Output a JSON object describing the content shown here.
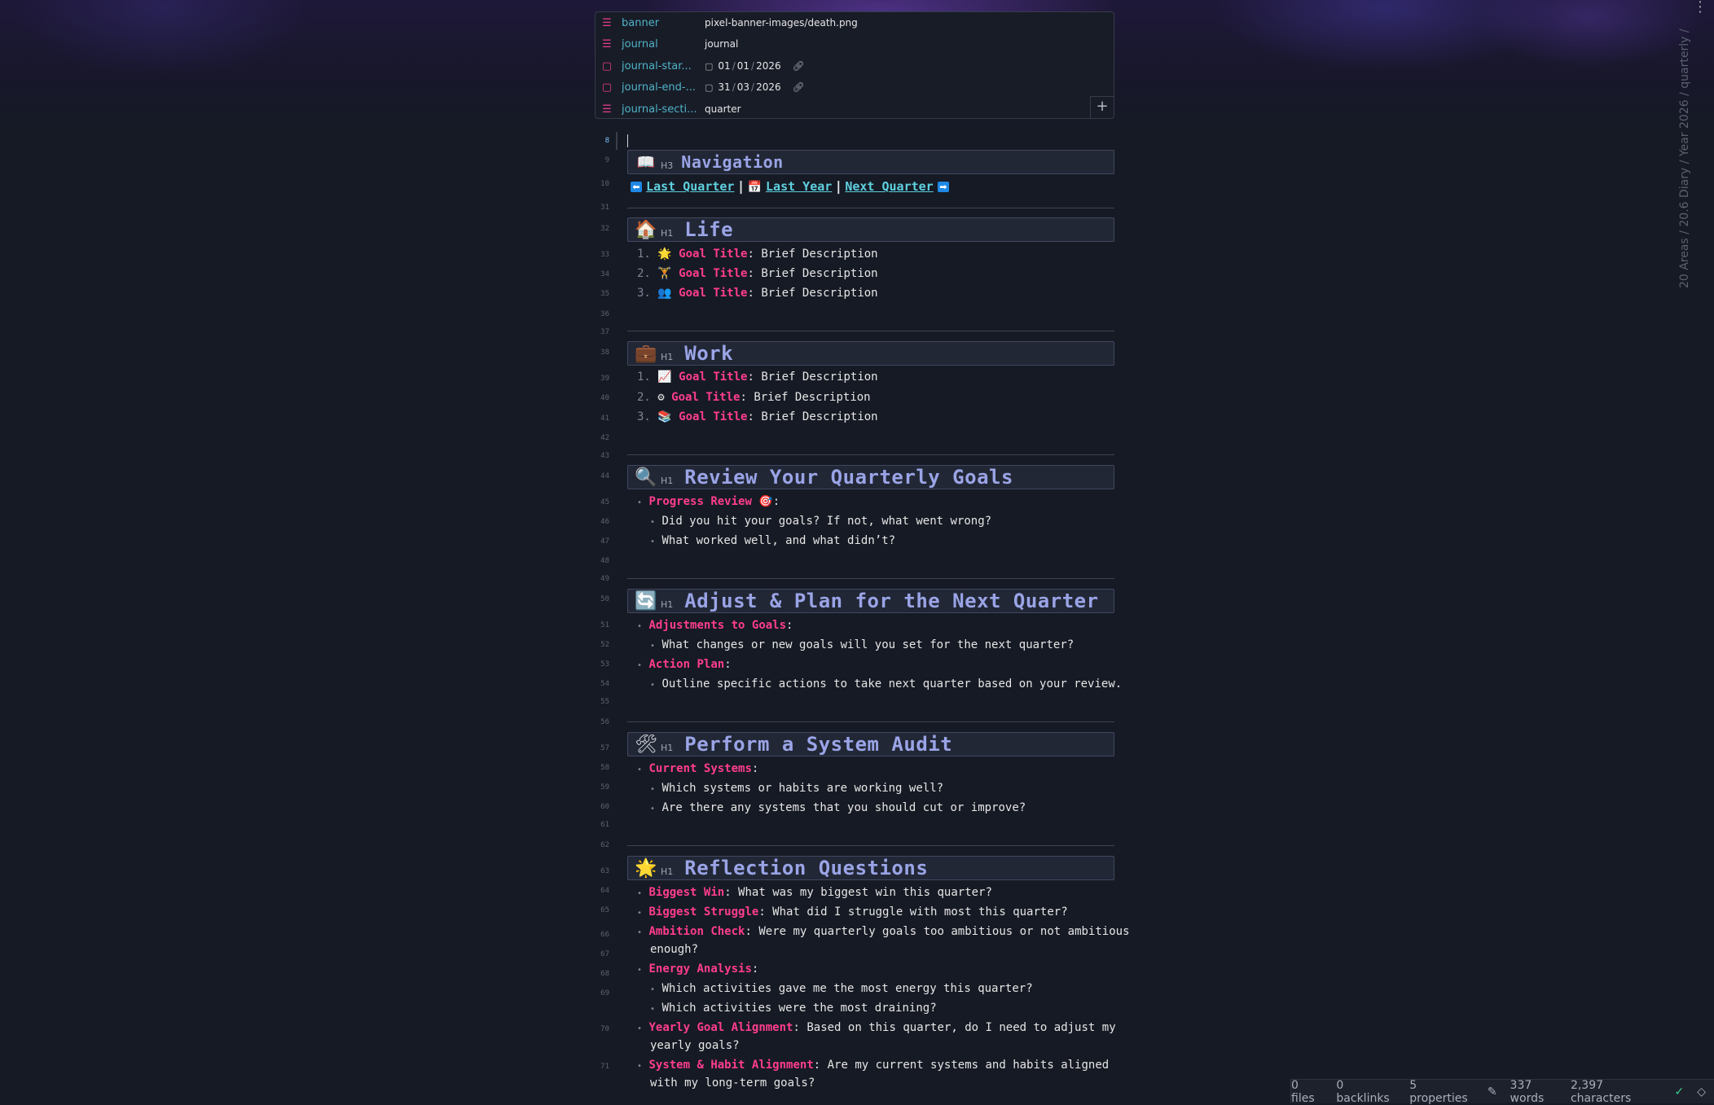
{
  "vertical_path": "20 Areas / 20.6 Diary / Year 2026 / quarterly /",
  "properties": [
    {
      "icon": "text-lines-icon",
      "key": "banner",
      "value": "pixel-banner-images/death.png",
      "type": "text"
    },
    {
      "icon": "text-lines-icon",
      "key": "journal",
      "value": "journal",
      "type": "text"
    },
    {
      "icon": "calendar-icon",
      "key": "journal-star...",
      "date": [
        "01",
        "01",
        "2026"
      ],
      "type": "date"
    },
    {
      "icon": "calendar-icon",
      "key": "journal-end-...",
      "date": [
        "31",
        "03",
        "2026"
      ],
      "type": "date"
    },
    {
      "icon": "text-lines-icon",
      "key": "journal-secti...",
      "value": "quarter",
      "type": "text"
    }
  ],
  "add_property_label": "+",
  "navigation": {
    "emoji": "📖",
    "level": "H3",
    "title": "Navigation",
    "last_quarter": "Last Quarter",
    "last_year": "Last Year",
    "next_quarter": "Next Quarter",
    "sep": "|"
  },
  "life": {
    "emoji": "🏠",
    "level": "H1",
    "title": "Life",
    "items": [
      {
        "n": "1.",
        "emoji": "🌟",
        "key": "Goal Title",
        "desc": ": Brief Description"
      },
      {
        "n": "2.",
        "emoji": "🏋",
        "key": "Goal Title",
        "desc": ": Brief Description"
      },
      {
        "n": "3.",
        "emoji": "👥",
        "key": "Goal Title",
        "desc": ": Brief Description"
      }
    ]
  },
  "work": {
    "emoji": "💼",
    "level": "H1",
    "title": "Work",
    "items": [
      {
        "n": "1.",
        "emoji": "📈",
        "key": "Goal Title",
        "desc": ": Brief Description"
      },
      {
        "n": "2.",
        "emoji": "⚙",
        "key": "Goal Title",
        "desc": ": Brief Description"
      },
      {
        "n": "3.",
        "emoji": "📚",
        "key": "Goal Title",
        "desc": ": Brief Description"
      }
    ]
  },
  "review": {
    "emoji": "🔍",
    "level": "H1",
    "title": "Review Your Quarterly Goals",
    "progress_key": "Progress Review",
    "progress_emoji": "🎯",
    "progress_colon": ":",
    "q1": "Did you hit your goals? If not, what went wrong?",
    "q2": "What worked well, and what didn’t?"
  },
  "adjust": {
    "emoji": "🔄",
    "level": "H1",
    "title": "Adjust & Plan for the Next Quarter",
    "k1": "Adjustments to Goals",
    "c1": ":",
    "q1": "What changes or new goals will you set for the next quarter?",
    "k2": "Action Plan",
    "c2": ":",
    "q2": "Outline specific actions to take next quarter based on your review."
  },
  "audit": {
    "emoji": "🛠",
    "level": "H1",
    "title": "Perform a System Audit",
    "k1": "Current Systems",
    "c1": ":",
    "q1": "Which systems or habits are working well?",
    "q2": "Are there any systems that you should cut or improve?"
  },
  "reflection": {
    "emoji": "🌟",
    "level": "H1",
    "title": "Reflection Questions",
    "biggest_win_k": "Biggest Win",
    "biggest_win_v": ": What was my biggest win this quarter?",
    "struggle_k": "Biggest Struggle",
    "struggle_v": ": What did I struggle with most this quarter?",
    "ambition_k": "Ambition Check",
    "ambition_v": ": Were my quarterly goals too ambitious or not ambitious",
    "ambition_v2": "enough?",
    "energy_k": "Energy Analysis",
    "energy_c": ":",
    "energy_q1": "Which activities gave me the most energy this quarter?",
    "energy_q2": "Which activities were the most draining?",
    "yearly_k": "Yearly Goal Alignment",
    "yearly_v": ": Based on this quarter, do I need to adjust my",
    "yearly_v2": "yearly goals?",
    "system_k": "System & Habit Alignment",
    "system_v": ": Are my current systems and habits aligned",
    "system_v2": "with my long-term goals?"
  },
  "line_numbers": [
    "8",
    "9",
    "10",
    "31",
    "32",
    "33",
    "34",
    "35",
    "36",
    "37",
    "38",
    "39",
    "40",
    "41",
    "42",
    "43",
    "44",
    "45",
    "46",
    "47",
    "48",
    "49",
    "50",
    "51",
    "52",
    "53",
    "54",
    "55",
    "56",
    "57",
    "58",
    "59",
    "60",
    "61",
    "62",
    "63",
    "64",
    "65",
    "66",
    "67",
    "68",
    "69",
    "70",
    "71"
  ],
  "status": {
    "files": "0 files",
    "backlinks": "0 backlinks",
    "properties": "5 properties",
    "words": "337 words",
    "chars": "2,397 characters"
  }
}
